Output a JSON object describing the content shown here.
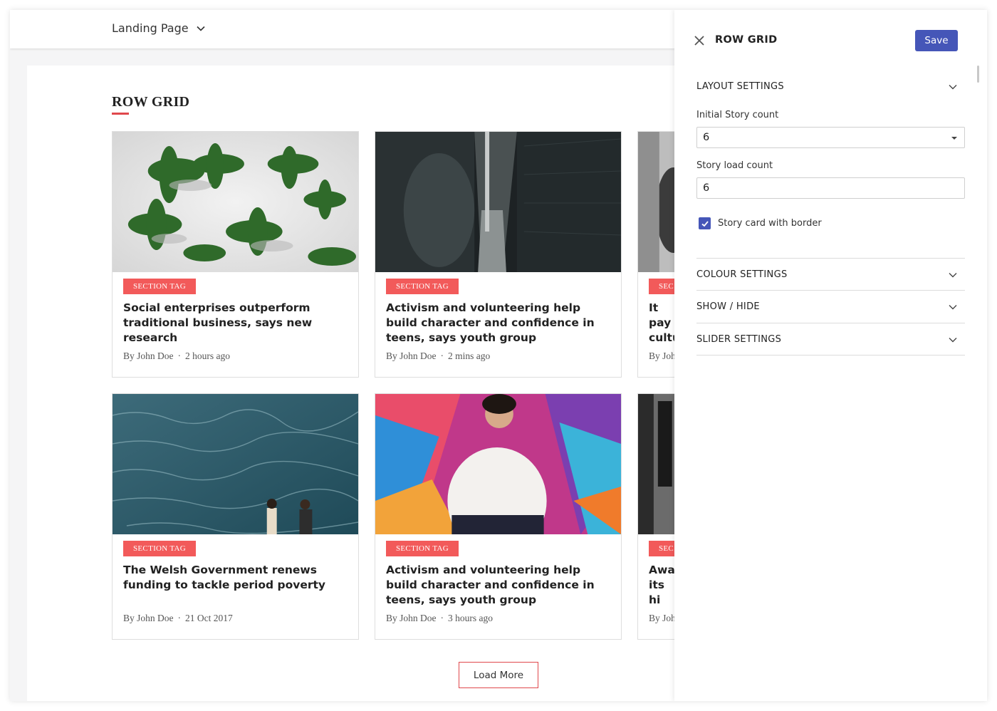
{
  "topbar": {
    "page_name": "Landing Page"
  },
  "canvas": {
    "section_title": "ROW GRID"
  },
  "cards": [
    {
      "tag": "SECTION TAG",
      "headline": "Social enterprises outperform traditional business, says new research",
      "author": "By John Doe",
      "time": "2 hours ago"
    },
    {
      "tag": "SECTION TAG",
      "headline": "Activism and volunteering help build character and confidence in teens, says youth group",
      "author": "By John Doe",
      "time": "2 mins ago"
    },
    {
      "tag": "SEC",
      "headline": "It pay cultu",
      "author": "By Joh",
      "time": ""
    },
    {
      "tag": "SECTION TAG",
      "headline": "The Welsh Government renews funding to tackle period poverty",
      "author": "By John Doe",
      "time": "21 Oct 2017"
    },
    {
      "tag": "SECTION TAG",
      "headline": "Activism and volunteering help build character and confidence in teens, says youth group",
      "author": "By John Doe",
      "time": "3 hours ago"
    },
    {
      "tag": "SEC",
      "headline": "Awar its hi",
      "author": "By Joh",
      "time": ""
    }
  ],
  "load_more_label": "Load More",
  "panel": {
    "title": "ROW GRID",
    "save_label": "Save",
    "layout": {
      "label": "LAYOUT SETTINGS",
      "initial_story_label": "Initial Story count",
      "initial_story_value": "6",
      "load_count_label": "Story load count",
      "load_count_value": "6",
      "border_checkbox_label": "Story card with border",
      "border_checked": true
    },
    "sections": [
      "COLOUR SETTINGS",
      "SHOW / HIDE",
      "SLIDER SETTINGS"
    ]
  },
  "colors": {
    "accent_red": "#f25a5a",
    "primary_blue": "#4556b8",
    "underline_red": "#e0484c"
  },
  "icons": {
    "page_dropdown": "chevron-down-icon",
    "close": "close-icon",
    "accordion": "chevron-down-icon",
    "checkbox": "check-icon"
  }
}
